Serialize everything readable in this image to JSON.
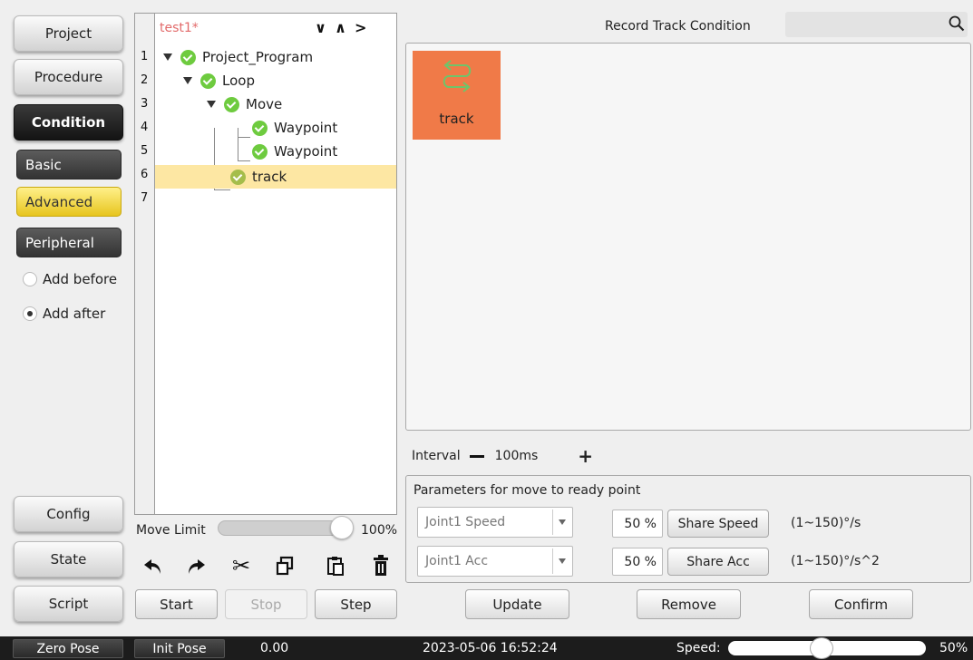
{
  "nav": {
    "project": "Project",
    "procedure": "Procedure",
    "condition": "Condition",
    "config": "Config",
    "state": "State",
    "script": "Script"
  },
  "condition_tabs": {
    "basic": "Basic",
    "advanced": "Advanced",
    "peripheral": "Peripheral"
  },
  "insert_mode": {
    "before": "Add before",
    "after": "Add after",
    "selected": "after"
  },
  "tree": {
    "file_name": "test1*",
    "line_numbers": [
      "1",
      "2",
      "3",
      "4",
      "5",
      "6",
      "7"
    ],
    "nodes": [
      {
        "label": "Project_Program",
        "status": "ok",
        "expanded": true
      },
      {
        "label": "Loop",
        "status": "ok",
        "expanded": true
      },
      {
        "label": "Move",
        "status": "ok",
        "expanded": true
      },
      {
        "label": "Waypoint",
        "status": "ok"
      },
      {
        "label": "Waypoint",
        "status": "ok"
      },
      {
        "label": "track",
        "status": "ok",
        "selected": true
      }
    ]
  },
  "move_limit": {
    "label": "Move Limit",
    "value_text": "100%",
    "value": 1.0
  },
  "tools": [
    "undo-icon",
    "redo-icon",
    "cut-icon",
    "copy-icon",
    "paste-icon",
    "delete-icon"
  ],
  "program_buttons": {
    "start": "Start",
    "stop": "Stop",
    "step": "Step"
  },
  "right_panel": {
    "title": "Record Track Condition",
    "search_placeholder": "",
    "card": {
      "label": "track",
      "color": "#f07a48"
    },
    "interval": {
      "label": "Interval",
      "value": "100ms"
    },
    "params": {
      "title": "Parameters for move to ready point",
      "speed": {
        "combo": "Joint1 Speed",
        "percent": "50 %",
        "button": "Share Speed",
        "range": "(1~150)°/s"
      },
      "acc": {
        "combo": "Joint1 Acc",
        "percent": "50 %",
        "button": "Share Acc",
        "range": "(1~150)°/s^2"
      }
    },
    "actions": {
      "update": "Update",
      "remove": "Remove",
      "confirm": "Confirm"
    }
  },
  "statusbar": {
    "zero_pose": "Zero Pose",
    "init_pose": "Init Pose",
    "value": "0.00",
    "datetime": "2023-05-06 16:52:24",
    "speed_label": "Speed:",
    "speed_value": "50%",
    "speed": 0.5
  }
}
